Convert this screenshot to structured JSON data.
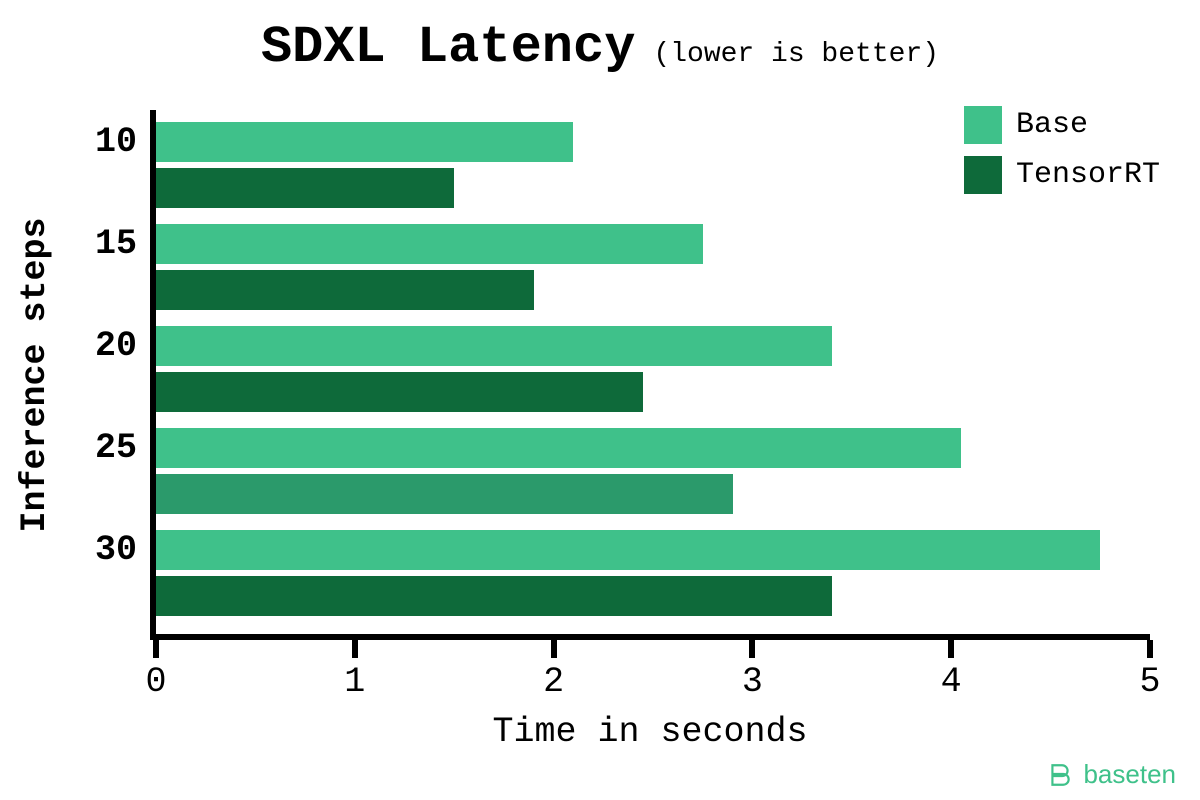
{
  "title_main": "SDXL Latency",
  "title_sub": "(lower is better)",
  "xlabel": "Time in seconds",
  "ylabel": "Inference steps",
  "legend": {
    "base": "Base",
    "trt": "TensorRT"
  },
  "brand": "baseten",
  "colors": {
    "base": "#3fc18a",
    "trt": "#0e6a3a",
    "axis": "#000000"
  },
  "chart_data": {
    "type": "bar",
    "orientation": "horizontal",
    "xlabel": "Time in seconds",
    "ylabel": "Inference steps",
    "categories": [
      "10",
      "15",
      "20",
      "25",
      "30"
    ],
    "series": [
      {
        "name": "Base",
        "values": [
          2.1,
          2.75,
          3.4,
          4.05,
          4.75
        ]
      },
      {
        "name": "TensorRT",
        "values": [
          1.5,
          1.9,
          2.45,
          2.9,
          3.4
        ]
      }
    ],
    "xlim": [
      0,
      5
    ],
    "x_ticks": [
      0,
      1,
      2,
      3,
      4,
      5
    ],
    "title": "SDXL Latency",
    "subtitle": "(lower is better)"
  }
}
